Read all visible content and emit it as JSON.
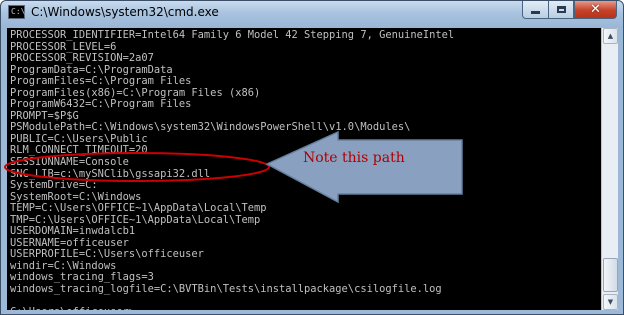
{
  "window": {
    "title": "C:\\Windows\\system32\\cmd.exe",
    "app_icon_text": "C:\\",
    "buttons": [
      "minimize",
      "maximize",
      "close"
    ],
    "close_glyph": "✕"
  },
  "console": {
    "lines": [
      "PROCESSOR_IDENTIFIER=Intel64 Family 6 Model 42 Stepping 7, GenuineIntel",
      "PROCESSOR_LEVEL=6",
      "PROCESSOR_REVISION=2a07",
      "ProgramData=C:\\ProgramData",
      "ProgramFiles=C:\\Program Files",
      "ProgramFiles(x86)=C:\\Program Files (x86)",
      "ProgramW6432=C:\\Program Files",
      "PROMPT=$P$G",
      "PSModulePath=C:\\Windows\\system32\\WindowsPowerShell\\v1.0\\Modules\\",
      "PUBLIC=C:\\Users\\Public",
      "RLM_CONNECT_TIMEOUT=20",
      "SESSIONNAME=Console",
      "SNC_LIB=c:\\mySNClib\\gssapi32.dll",
      "SystemDrive=C:",
      "SystemRoot=C:\\Windows",
      "TEMP=C:\\Users\\OFFICE~1\\AppData\\Local\\Temp",
      "TMP=C:\\Users\\OFFICE~1\\AppData\\Local\\Temp",
      "USERDOMAIN=inwdalcb1",
      "USERNAME=officeuser",
      "USERPROFILE=C:\\Users\\officeuser",
      "windir=C:\\Windows",
      "windows_tracing_flags=3",
      "windows_tracing_logfile=C:\\BVTBin\\Tests\\installpackage\\csilogfile.log",
      "",
      "C:\\Users\\officeuser>_"
    ]
  },
  "annotation": {
    "text": "Note this path",
    "color": "#b00000",
    "arrow_fill": "#8aa0c0"
  },
  "colors": {
    "console_background": "#000000",
    "console_text": "#c0c0c0",
    "title_bar": "#a9c3df",
    "highlight_ellipse": "#cc0000"
  }
}
